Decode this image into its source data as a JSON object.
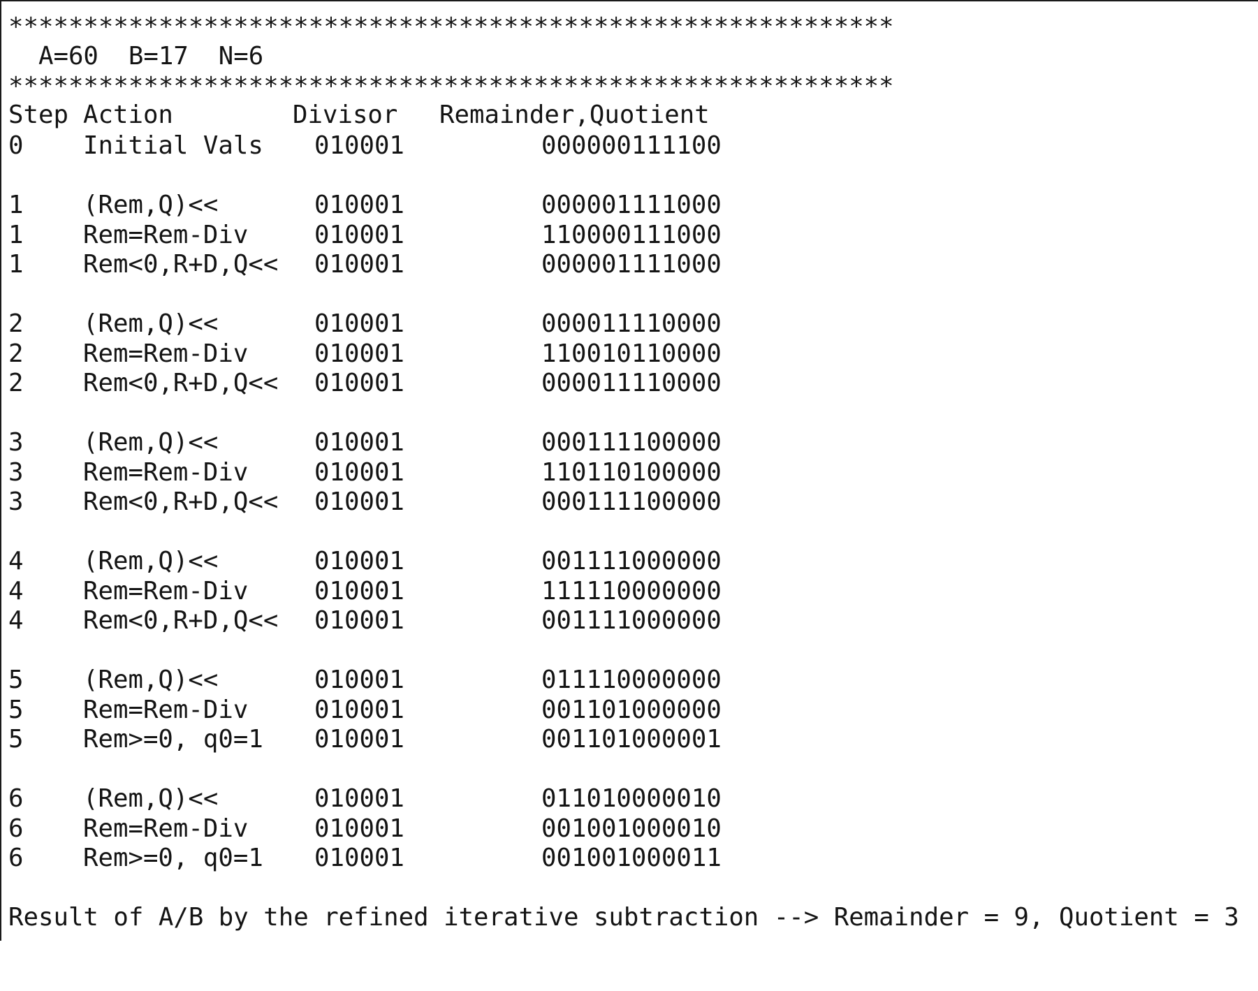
{
  "terminal": {
    "separator": "***********************************************************",
    "params_line": "  A=60  B=17  N=6",
    "params": {
      "A": 60,
      "B": 17,
      "N": 6
    },
    "headers": {
      "step": "Step",
      "action": "Action",
      "divisor": "Divisor",
      "remainder_quotient": "Remainder,Quotient"
    },
    "rows": [
      {
        "step": "0",
        "action": "Initial Vals",
        "divisor": "010001",
        "rem_quot": "000000111100"
      },
      {
        "step": "1",
        "action": "(Rem,Q)<<",
        "divisor": "010001",
        "rem_quot": "000001111000"
      },
      {
        "step": "1",
        "action": "Rem=Rem-Div",
        "divisor": "010001",
        "rem_quot": "110000111000"
      },
      {
        "step": "1",
        "action": "Rem<0,R+D,Q<<",
        "divisor": "010001",
        "rem_quot": "000001111000"
      },
      {
        "step": "2",
        "action": "(Rem,Q)<<",
        "divisor": "010001",
        "rem_quot": "000011110000"
      },
      {
        "step": "2",
        "action": "Rem=Rem-Div",
        "divisor": "010001",
        "rem_quot": "110010110000"
      },
      {
        "step": "2",
        "action": "Rem<0,R+D,Q<<",
        "divisor": "010001",
        "rem_quot": "000011110000"
      },
      {
        "step": "3",
        "action": "(Rem,Q)<<",
        "divisor": "010001",
        "rem_quot": "000111100000"
      },
      {
        "step": "3",
        "action": "Rem=Rem-Div",
        "divisor": "010001",
        "rem_quot": "110110100000"
      },
      {
        "step": "3",
        "action": "Rem<0,R+D,Q<<",
        "divisor": "010001",
        "rem_quot": "000111100000"
      },
      {
        "step": "4",
        "action": "(Rem,Q)<<",
        "divisor": "010001",
        "rem_quot": "001111000000"
      },
      {
        "step": "4",
        "action": "Rem=Rem-Div",
        "divisor": "010001",
        "rem_quot": "111110000000"
      },
      {
        "step": "4",
        "action": "Rem<0,R+D,Q<<",
        "divisor": "010001",
        "rem_quot": "001111000000"
      },
      {
        "step": "5",
        "action": "(Rem,Q)<<",
        "divisor": "010001",
        "rem_quot": "011110000000"
      },
      {
        "step": "5",
        "action": "Rem=Rem-Div",
        "divisor": "010001",
        "rem_quot": "001101000000"
      },
      {
        "step": "5",
        "action": "Rem>=0, q0=1",
        "divisor": "010001",
        "rem_quot": "001101000001"
      },
      {
        "step": "6",
        "action": "(Rem,Q)<<",
        "divisor": "010001",
        "rem_quot": "011010000010"
      },
      {
        "step": "6",
        "action": "Rem=Rem-Div",
        "divisor": "010001",
        "rem_quot": "001001000010"
      },
      {
        "step": "6",
        "action": "Rem>=0, q0=1",
        "divisor": "010001",
        "rem_quot": "001001000011"
      }
    ],
    "result_line": "Result of A/B by the refined iterative subtraction --> Remainder = 9, Quotient = 3",
    "result": {
      "remainder": 9,
      "quotient": 3
    }
  }
}
